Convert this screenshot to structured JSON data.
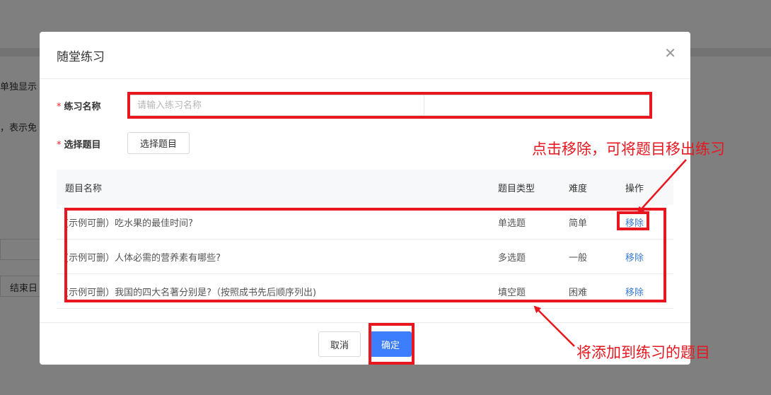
{
  "background": {
    "text_1": "单独显示",
    "text_2": "，表示免",
    "text_3": "结束日"
  },
  "dialog": {
    "title": "随堂练习",
    "close_icon": "close-icon",
    "practice_name": {
      "label": "练习名称",
      "required_mark": "*",
      "placeholder": "请输入练习名称",
      "value": ""
    },
    "select_question": {
      "label": "选择题目",
      "required_mark": "*",
      "button_label": "选择题目"
    },
    "table": {
      "headers": {
        "name": "题目名称",
        "type": "题目类型",
        "difficulty": "难度",
        "operation": "操作"
      },
      "rows": [
        {
          "name": "(示例可删）吃水果的最佳时间?",
          "type": "单选题",
          "difficulty": "简单",
          "action": "移除"
        },
        {
          "name": "(示例可删）人体必需的营养素有哪些?",
          "type": "多选题",
          "difficulty": "一般",
          "action": "移除"
        },
        {
          "name": "(示例可删）我国的四大名著分别是?（按照成书先后顺序列出)",
          "type": "填空题",
          "difficulty": "困难",
          "action": "移除"
        }
      ]
    },
    "footer": {
      "cancel_label": "取消",
      "ok_label": "确定"
    }
  },
  "annotations": {
    "remove_hint": "点击移除，可将题目移出练习",
    "added_hint": "将添加到练习的题目",
    "color": "#e8161f"
  }
}
